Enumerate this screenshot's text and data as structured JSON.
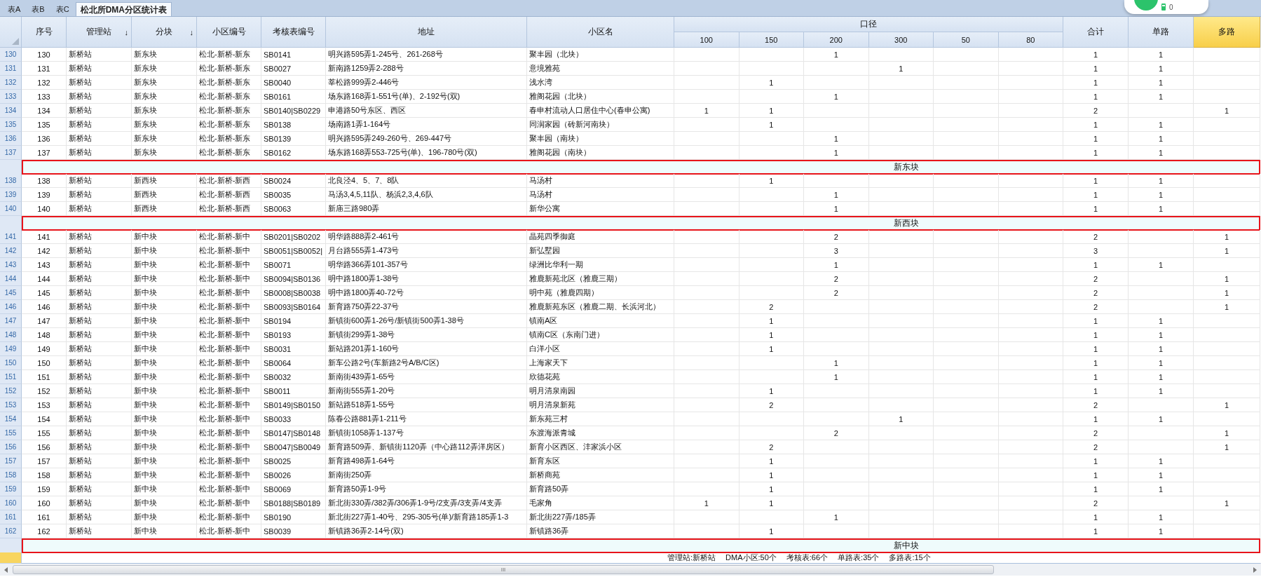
{
  "tabs": [
    {
      "label": "表A",
      "selected": false
    },
    {
      "label": "表B",
      "selected": false
    },
    {
      "label": "表C",
      "selected": false
    },
    {
      "label": "松北所DMA分区统计表",
      "selected": true
    }
  ],
  "overlay_badge": {
    "count": "0"
  },
  "header": {
    "columns_left": [
      {
        "label": "序号",
        "selected": false
      },
      {
        "label": "管理站",
        "sort_indicator": "↓",
        "selected": false
      },
      {
        "label": "分块",
        "sort_indicator": "↓",
        "selected": false
      },
      {
        "label": "小区编号",
        "selected": false
      },
      {
        "label": "考核表编号",
        "selected": false
      },
      {
        "label": "地址",
        "selected": false
      },
      {
        "label": "小区名",
        "selected": false
      }
    ],
    "caliber": {
      "label": "口径",
      "columns": [
        "100",
        "150",
        "200",
        "300",
        "50",
        "80"
      ]
    },
    "columns_right": [
      {
        "label": "合计",
        "selected": false
      },
      {
        "label": "单路",
        "selected": false
      },
      {
        "label": "多路",
        "selected": true
      }
    ]
  },
  "rows": [
    {
      "kind": "data",
      "row_number": "130",
      "cells": [
        "130",
        "新桥站",
        "新东块",
        "松北-新桥-新东",
        "SB0141",
        "明兴路595弄1-245号、261-268号",
        "聚丰园（北块）",
        null,
        null,
        "1",
        null,
        null,
        null,
        "1",
        "1",
        null
      ]
    },
    {
      "kind": "data",
      "row_number": "131",
      "cells": [
        "131",
        "新桥站",
        "新东块",
        "松北-新桥-新东",
        "SB0027",
        "新南路1259弄2-288号",
        "意境雅苑",
        null,
        null,
        null,
        "1",
        null,
        null,
        "1",
        "1",
        null
      ]
    },
    {
      "kind": "data",
      "row_number": "132",
      "cells": [
        "132",
        "新桥站",
        "新东块",
        "松北-新桥-新东",
        "SB0040",
        "莘松路999弄2-446号",
        "浅水湾",
        null,
        "1",
        null,
        null,
        null,
        null,
        "1",
        "1",
        null
      ]
    },
    {
      "kind": "data",
      "row_number": "133",
      "cells": [
        "133",
        "新桥站",
        "新东块",
        "松北-新桥-新东",
        "SB0161",
        "场东路168弄1-551号(单)、2-192号(双)",
        "雅阁花园（北块）",
        null,
        null,
        "1",
        null,
        null,
        null,
        "1",
        "1",
        null
      ]
    },
    {
      "kind": "data",
      "row_number": "134",
      "cells": [
        "134",
        "新桥站",
        "新东块",
        "松北-新桥-新东",
        "SB0140|SB0229",
        "申港路50号东区、西区",
        "春申村流动人口居住中心(春申公寓)",
        "1",
        "1",
        null,
        null,
        null,
        null,
        "2",
        null,
        "1"
      ]
    },
    {
      "kind": "data",
      "row_number": "135",
      "cells": [
        "135",
        "新桥站",
        "新东块",
        "松北-新桥-新东",
        "SB0138",
        "场南路1弄1-164号",
        "同润家园（砖新河南块）",
        null,
        "1",
        null,
        null,
        null,
        null,
        "1",
        "1",
        null
      ]
    },
    {
      "kind": "data",
      "row_number": "136",
      "cells": [
        "136",
        "新桥站",
        "新东块",
        "松北-新桥-新东",
        "SB0139",
        "明兴路595弄249-260号、269-447号",
        "聚丰园（南块）",
        null,
        null,
        "1",
        null,
        null,
        null,
        "1",
        "1",
        null
      ]
    },
    {
      "kind": "data",
      "row_number": "137",
      "cells": [
        "137",
        "新桥站",
        "新东块",
        "松北-新桥-新东",
        "SB0162",
        "场东路168弄553-725号(单)、196-780号(双)",
        "雅阁花园（南块）",
        null,
        null,
        "1",
        null,
        null,
        null,
        "1",
        "1",
        null
      ]
    },
    {
      "kind": "group",
      "label": "新东块",
      "outlined": true
    },
    {
      "kind": "data",
      "row_number": "138",
      "cells": [
        "138",
        "新桥站",
        "新西块",
        "松北-新桥-新西",
        "SB0024",
        "北良泾4、5、7、8队",
        "马汤村",
        null,
        "1",
        null,
        null,
        null,
        null,
        "1",
        "1",
        null
      ]
    },
    {
      "kind": "data",
      "row_number": "139",
      "cells": [
        "139",
        "新桥站",
        "新西块",
        "松北-新桥-新西",
        "SB0035",
        "马汤3,4,5,11队、杨浜2,3,4,6队",
        "马汤村",
        null,
        null,
        "1",
        null,
        null,
        null,
        "1",
        "1",
        null
      ]
    },
    {
      "kind": "data",
      "row_number": "140",
      "cells": [
        "140",
        "新桥站",
        "新西块",
        "松北-新桥-新西",
        "SB0063",
        "新庙三路980弄",
        "新华公寓",
        null,
        null,
        "1",
        null,
        null,
        null,
        "1",
        "1",
        null
      ]
    },
    {
      "kind": "group",
      "label": "新西块",
      "outlined": true
    },
    {
      "kind": "data",
      "row_number": "141",
      "cells": [
        "141",
        "新桥站",
        "新中块",
        "松北-新桥-新中",
        "SB0201|SB0202",
        "明华路888弄2-461号",
        "晶苑四季御庭",
        null,
        null,
        "2",
        null,
        null,
        null,
        "2",
        null,
        "1"
      ]
    },
    {
      "kind": "data",
      "row_number": "142",
      "cells": [
        "142",
        "新桥站",
        "新中块",
        "松北-新桥-新中",
        "SB0051|SB0052|",
        "月台路555弄1-473号",
        "新弘墅园",
        null,
        null,
        "3",
        null,
        null,
        null,
        "3",
        null,
        "1"
      ]
    },
    {
      "kind": "data",
      "row_number": "143",
      "cells": [
        "143",
        "新桥站",
        "新中块",
        "松北-新桥-新中",
        "SB0071",
        "明华路366弄101-357号",
        "绿洲比华利一期",
        null,
        null,
        "1",
        null,
        null,
        null,
        "1",
        "1",
        null
      ]
    },
    {
      "kind": "data",
      "row_number": "144",
      "cells": [
        "144",
        "新桥站",
        "新中块",
        "松北-新桥-新中",
        "SB0094|SB0136",
        "明中路1800弄1-38号",
        "雅鹿新苑北区（雅鹿三期）",
        null,
        null,
        "2",
        null,
        null,
        null,
        "2",
        null,
        "1"
      ]
    },
    {
      "kind": "data",
      "row_number": "145",
      "cells": [
        "145",
        "新桥站",
        "新中块",
        "松北-新桥-新中",
        "SB0008|SB0038",
        "明中路1800弄40-72号",
        "明中苑（雅鹿四期）",
        null,
        null,
        "2",
        null,
        null,
        null,
        "2",
        null,
        "1"
      ]
    },
    {
      "kind": "data",
      "row_number": "146",
      "cells": [
        "146",
        "新桥站",
        "新中块",
        "松北-新桥-新中",
        "SB0093|SB0164",
        "新育路750弄22-37号",
        "雅鹿新苑东区（雅鹿二期、长浜河北）",
        null,
        "2",
        null,
        null,
        null,
        null,
        "2",
        null,
        "1"
      ]
    },
    {
      "kind": "data",
      "row_number": "147",
      "cells": [
        "147",
        "新桥站",
        "新中块",
        "松北-新桥-新中",
        "SB0194",
        "新镇街600弄1-26号/新镇街500弄1-38号",
        "镇南A区",
        null,
        "1",
        null,
        null,
        null,
        null,
        "1",
        "1",
        null
      ]
    },
    {
      "kind": "data",
      "row_number": "148",
      "cells": [
        "148",
        "新桥站",
        "新中块",
        "松北-新桥-新中",
        "SB0193",
        "新镇街299弄1-38号",
        "镇南C区（东南门进）",
        null,
        "1",
        null,
        null,
        null,
        null,
        "1",
        "1",
        null
      ]
    },
    {
      "kind": "data",
      "row_number": "149",
      "cells": [
        "149",
        "新桥站",
        "新中块",
        "松北-新桥-新中",
        "SB0031",
        "新站路201弄1-160号",
        "白洋小区",
        null,
        "1",
        null,
        null,
        null,
        null,
        "1",
        "1",
        null
      ]
    },
    {
      "kind": "data",
      "row_number": "150",
      "cells": [
        "150",
        "新桥站",
        "新中块",
        "松北-新桥-新中",
        "SB0064",
        "新车公路2号(车新路2号A/B/C区)",
        "上海家天下",
        null,
        null,
        "1",
        null,
        null,
        null,
        "1",
        "1",
        null
      ]
    },
    {
      "kind": "data",
      "row_number": "151",
      "cells": [
        "151",
        "新桥站",
        "新中块",
        "松北-新桥-新中",
        "SB0032",
        "新南街439弄1-65号",
        "欣德花苑",
        null,
        null,
        "1",
        null,
        null,
        null,
        "1",
        "1",
        null
      ]
    },
    {
      "kind": "data",
      "row_number": "152",
      "cells": [
        "152",
        "新桥站",
        "新中块",
        "松北-新桥-新中",
        "SB0011",
        "新南街555弄1-20号",
        "明月清泉南园",
        null,
        "1",
        null,
        null,
        null,
        null,
        "1",
        "1",
        null
      ]
    },
    {
      "kind": "data",
      "row_number": "153",
      "cells": [
        "153",
        "新桥站",
        "新中块",
        "松北-新桥-新中",
        "SB0149|SB0150",
        "新站路518弄1-55号",
        "明月清泉新苑",
        null,
        "2",
        null,
        null,
        null,
        null,
        "2",
        null,
        "1"
      ]
    },
    {
      "kind": "data",
      "row_number": "154",
      "cells": [
        "154",
        "新桥站",
        "新中块",
        "松北-新桥-新中",
        "SB0033",
        "陈春公路881弄1-211号",
        "新东苑三村",
        null,
        null,
        null,
        "1",
        null,
        null,
        "1",
        "1",
        null
      ]
    },
    {
      "kind": "data",
      "row_number": "155",
      "cells": [
        "155",
        "新桥站",
        "新中块",
        "松北-新桥-新中",
        "SB0147|SB0148",
        "新镇街1058弄1-137号",
        "东渡海派青城",
        null,
        null,
        "2",
        null,
        null,
        null,
        "2",
        null,
        "1"
      ]
    },
    {
      "kind": "data",
      "row_number": "156",
      "cells": [
        "156",
        "新桥站",
        "新中块",
        "松北-新桥-新中",
        "SB0047|SB0049",
        "新育路509弄、新镇街1120弄（中心路112弄洋房区）",
        "新育小区西区、沣家浜小区",
        null,
        "2",
        null,
        null,
        null,
        null,
        "2",
        null,
        "1"
      ]
    },
    {
      "kind": "data",
      "row_number": "157",
      "cells": [
        "157",
        "新桥站",
        "新中块",
        "松北-新桥-新中",
        "SB0025",
        "新育路498弄1-64号",
        "新育东区",
        null,
        "1",
        null,
        null,
        null,
        null,
        "1",
        "1",
        null
      ]
    },
    {
      "kind": "data",
      "row_number": "158",
      "cells": [
        "158",
        "新桥站",
        "新中块",
        "松北-新桥-新中",
        "SB0026",
        "新南街250弄",
        "新桥商苑",
        null,
        "1",
        null,
        null,
        null,
        null,
        "1",
        "1",
        null
      ]
    },
    {
      "kind": "data",
      "row_number": "159",
      "cells": [
        "159",
        "新桥站",
        "新中块",
        "松北-新桥-新中",
        "SB0069",
        "新育路50弄1-9号",
        "新育路50弄",
        null,
        "1",
        null,
        null,
        null,
        null,
        "1",
        "1",
        null
      ]
    },
    {
      "kind": "data",
      "row_number": "160",
      "cells": [
        "160",
        "新桥站",
        "新中块",
        "松北-新桥-新中",
        "SB0188|SB0189",
        "新北街330弄/382弄/306弄1-9号/2支弄/3支弄/4支弄",
        "毛家角",
        "1",
        "1",
        null,
        null,
        null,
        null,
        "2",
        null,
        "1"
      ]
    },
    {
      "kind": "data",
      "row_number": "161",
      "cells": [
        "161",
        "新桥站",
        "新中块",
        "松北-新桥-新中",
        "SB0190",
        "新北街227弄1-40号、295-305号(单)/新育路185弄1-3",
        "新北街227弄/185弄",
        null,
        null,
        "1",
        null,
        null,
        null,
        "1",
        "1",
        null
      ]
    },
    {
      "kind": "data",
      "row_number": "162",
      "cells": [
        "162",
        "新桥站",
        "新中块",
        "松北-新桥-新中",
        "SB0039",
        "新镇路36弄2-14号(双)",
        "新镇路36弄",
        null,
        "1",
        null,
        null,
        null,
        null,
        "1",
        "1",
        null
      ]
    },
    {
      "kind": "group",
      "label": "新中块",
      "outlined": true
    }
  ],
  "summary_row": {
    "selected": true,
    "items": [
      "管理站:新桥站",
      "DMA小区:50个",
      "考核表:66个",
      "单路表:35个",
      "多路表:15个"
    ]
  },
  "scrollbar_grip": "III"
}
